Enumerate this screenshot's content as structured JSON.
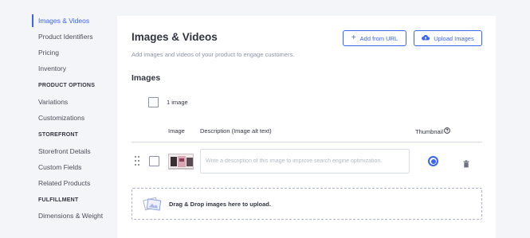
{
  "sidebar": {
    "items": [
      {
        "label": "Images & Videos",
        "active": true
      },
      {
        "label": "Product Identifiers"
      },
      {
        "label": "Pricing"
      },
      {
        "label": "Inventory"
      },
      {
        "label": "Variations"
      },
      {
        "label": "Customizations"
      },
      {
        "label": "Storefront Details"
      },
      {
        "label": "Custom Fields"
      },
      {
        "label": "Related Products"
      },
      {
        "label": "Dimensions & Weight"
      }
    ],
    "headings": {
      "product_options": "PRODUCT OPTIONS",
      "storefront": "STOREFRONT",
      "fulfillment": "FULFILLMENT"
    }
  },
  "main": {
    "title": "Images & Videos",
    "subtitle": "Add images and videos of your product to engage customers.",
    "add_url_label": "Add from URL",
    "upload_label": "Upload Images",
    "section_title": "Images",
    "image_count_label": "1 image",
    "table": {
      "headers": {
        "image": "Image",
        "description": "Description (Image alt text)",
        "thumbnail": "Thumbnail"
      },
      "rows": [
        {
          "description_placeholder": "Write a description of this image to improve search engine optimization.",
          "thumbnail_selected": true
        }
      ]
    },
    "dropzone_label": "Drag & Drop images here to upload."
  },
  "colors": {
    "accent": "#3c64f4",
    "text": "#313440",
    "muted": "#8c93a8",
    "border": "#d9dce9",
    "background": "#f4f5f8"
  },
  "icons": {
    "add_url": "plus-icon",
    "upload": "cloud-upload-icon",
    "thumbnail_help": "help-circle-icon",
    "drag": "drag-handle-icon",
    "delete": "trash-icon",
    "dropzone": "image-upload-icon"
  }
}
